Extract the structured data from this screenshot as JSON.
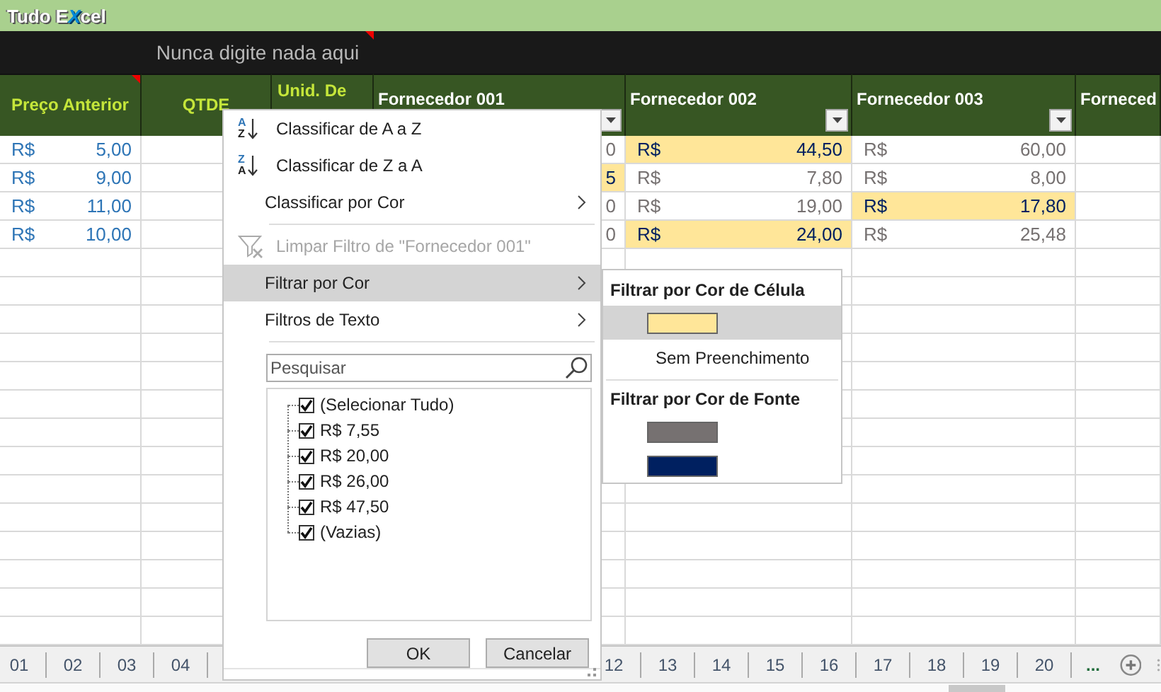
{
  "title": {
    "before": "Tudo E",
    "mark": "X",
    "after": "cel"
  },
  "notice": {
    "text": "Nunca digite nada aqui",
    "comment": true
  },
  "columns": [
    {
      "label": "Preço Anterior",
      "kind": "input",
      "comment": true,
      "filter": false
    },
    {
      "label": "QTDE",
      "kind": "input",
      "comment": false,
      "filter": false
    },
    {
      "label": "Unid. De",
      "kind": "input-top",
      "comment": false,
      "filter": false
    },
    {
      "label": "Fornecedor 001",
      "kind": "supplier",
      "comment": false,
      "filter": true
    },
    {
      "label": "Fornecedor 002",
      "kind": "supplier",
      "comment": false,
      "filter": true
    },
    {
      "label": "Fornecedor 003",
      "kind": "supplier",
      "comment": false,
      "filter": true
    },
    {
      "label": "Forneced",
      "kind": "supplier",
      "comment": false,
      "filter": false
    }
  ],
  "rows": [
    {
      "cells": [
        {
          "currency": "R$",
          "value": "5,00",
          "highlighted": false
        },
        null,
        null,
        {
          "value": "0",
          "highlighted": false
        },
        {
          "currency": "R$",
          "value": "44,50",
          "highlighted": true
        },
        {
          "currency": "R$",
          "value": "60,00",
          "highlighted": false
        },
        null
      ]
    },
    {
      "cells": [
        {
          "currency": "R$",
          "value": "9,00",
          "highlighted": false
        },
        null,
        null,
        {
          "value": "5",
          "highlighted": true
        },
        {
          "currency": "R$",
          "value": "7,80",
          "highlighted": false
        },
        {
          "currency": "R$",
          "value": "8,00",
          "highlighted": false
        },
        null
      ]
    },
    {
      "cells": [
        {
          "currency": "R$",
          "value": "11,00",
          "highlighted": false
        },
        null,
        null,
        {
          "value": "0",
          "highlighted": false
        },
        {
          "currency": "R$",
          "value": "19,00",
          "highlighted": false
        },
        {
          "currency": "R$",
          "value": "17,80",
          "highlighted": true
        },
        null
      ]
    },
    {
      "cells": [
        {
          "currency": "R$",
          "value": "10,00",
          "highlighted": false
        },
        null,
        null,
        {
          "value": "0",
          "highlighted": false
        },
        {
          "currency": "R$",
          "value": "24,00",
          "highlighted": true
        },
        {
          "currency": "R$",
          "value": "25,48",
          "highlighted": false
        },
        null
      ]
    }
  ],
  "filter_menu": {
    "items": [
      {
        "kind": "sort-ascending",
        "icon_letters": [
          "A",
          "Z"
        ],
        "label": "Classificar de A a Z",
        "disabled": false,
        "selected": false,
        "submenu": false
      },
      {
        "kind": "sort-descending",
        "icon_letters": [
          "Z",
          "A"
        ],
        "label": "Classificar de Z a A",
        "disabled": false,
        "selected": false,
        "submenu": false
      },
      {
        "kind": "command",
        "label": "Classificar por Cor",
        "disabled": false,
        "selected": false,
        "submenu": true
      },
      {
        "kind": "separator"
      },
      {
        "kind": "clear-filter",
        "label": "Limpar Filtro de \"Fornecedor 001\"",
        "disabled": true,
        "selected": false,
        "submenu": false
      },
      {
        "kind": "command",
        "label": "Filtrar por Cor",
        "disabled": false,
        "selected": true,
        "submenu": true
      },
      {
        "kind": "command",
        "label": "Filtros de Texto",
        "disabled": false,
        "selected": false,
        "submenu": true
      },
      {
        "kind": "separator"
      }
    ],
    "search": {
      "placeholder": "Pesquisar"
    },
    "values": [
      {
        "label": "(Selecionar Tudo)",
        "checked": true
      },
      {
        "label": "R$ 7,55",
        "checked": true
      },
      {
        "label": "R$ 20,00",
        "checked": true
      },
      {
        "label": "R$ 26,00",
        "checked": true
      },
      {
        "label": "R$ 47,50",
        "checked": true
      },
      {
        "label": "(Vazias)",
        "checked": true
      }
    ],
    "buttons": [
      "OK",
      "Cancelar"
    ]
  },
  "color_submenu": [
    {
      "kind": "heading",
      "label": "Filtrar por Cor de Célula"
    },
    {
      "kind": "swatch",
      "color": "#ffe699",
      "selected": true
    },
    {
      "kind": "option",
      "label": "Sem Preenchimento",
      "selected": false
    },
    {
      "kind": "separator"
    },
    {
      "kind": "heading",
      "label": "Filtrar por Cor de Fonte"
    },
    {
      "kind": "swatch",
      "color": "#767171",
      "selected": false
    },
    {
      "kind": "swatch",
      "color": "#002060",
      "selected": false
    }
  ],
  "sheet_tabs": [
    {
      "label": "01"
    },
    {
      "label": "02"
    },
    {
      "label": "03"
    },
    {
      "label": "04"
    }
  ],
  "sheet_tabs_right": [
    {
      "label": "12"
    },
    {
      "label": "13"
    },
    {
      "label": "14"
    },
    {
      "label": "15"
    },
    {
      "label": "16"
    },
    {
      "label": "17"
    },
    {
      "label": "18"
    },
    {
      "label": "19"
    },
    {
      "label": "20"
    }
  ],
  "more_tabs": "..."
}
